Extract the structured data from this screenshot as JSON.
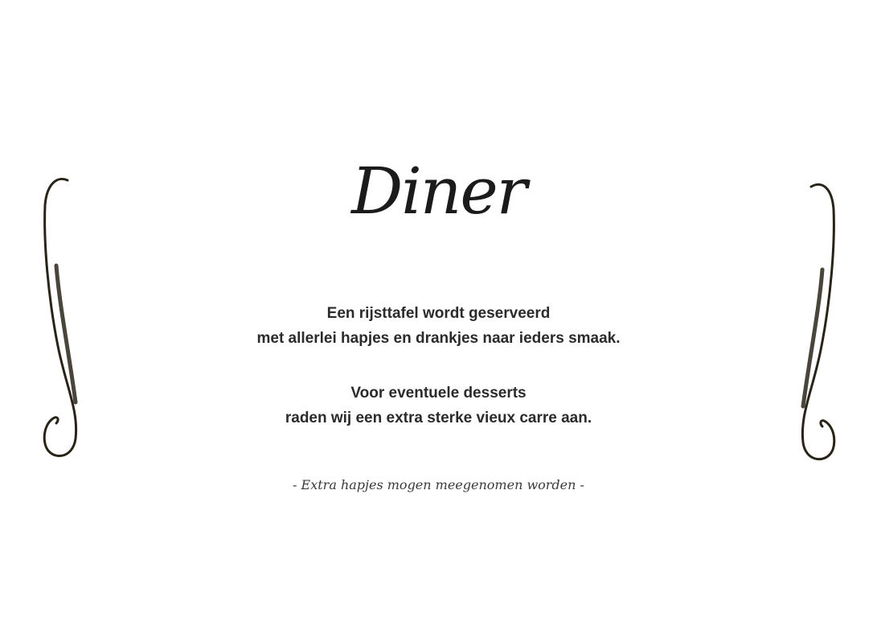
{
  "menu": {
    "title": "Diner",
    "paragraph_1": {
      "line_1": "Een rijsttafel wordt geserveerd",
      "line_2": "met allerlei hapjes en drankjes naar ieders smaak."
    },
    "paragraph_2": {
      "line_1": "Voor eventuele desserts",
      "line_2": "raden wij een extra sterke vieux carre aan."
    },
    "footnote": "- Extra hapjes mogen meegenomen worden -"
  },
  "decorations": {
    "left": "flourish-scroll-icon",
    "right": "flourish-scroll-icon",
    "color": "#2a2418"
  }
}
